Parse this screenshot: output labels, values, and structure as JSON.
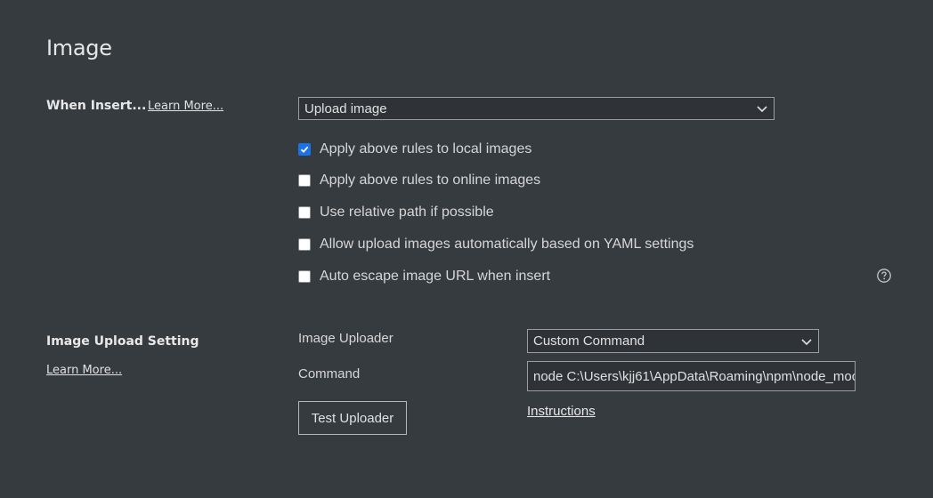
{
  "page": {
    "title": "Image"
  },
  "when_insert": {
    "label": "When Insert...",
    "learn_more": "Learn More...",
    "dropdown_value": "Upload image",
    "options": [
      {
        "label": "Apply above rules to local images",
        "checked": true
      },
      {
        "label": "Apply above rules to online images",
        "checked": false
      },
      {
        "label": "Use relative path if possible",
        "checked": false
      },
      {
        "label": "Allow upload images automatically based on YAML settings",
        "checked": false
      },
      {
        "label": "Auto escape image URL when insert",
        "checked": false
      }
    ],
    "help_icon": "question-circle-icon"
  },
  "upload_setting": {
    "label": "Image Upload Setting",
    "learn_more": "Learn More...",
    "uploader_label": "Image Uploader",
    "uploader_value": "Custom Command",
    "command_label": "Command",
    "command_value": "node C:\\Users\\kjj61\\AppData\\Roaming\\npm\\node_moc",
    "test_button": "Test Uploader",
    "instructions_link": "Instructions"
  },
  "colors": {
    "background": "#363b40",
    "checkbox_accent": "#1a73e8"
  }
}
